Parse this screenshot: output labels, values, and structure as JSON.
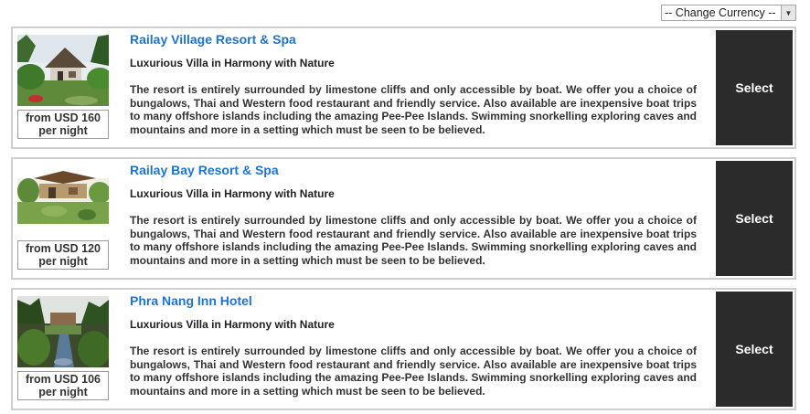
{
  "currency": {
    "label": "-- Change Currency --",
    "arrow_icon": "triangle-down"
  },
  "hotels": [
    {
      "name": "Railay Village Resort & Spa",
      "tagline": "Luxurious Villa in Harmony with Nature",
      "description": "The resort is entirely surrounded by limestone cliffs and only accessible by boat. We offer you a choice of bungalows, Thai and Western food restaurant and friendly service. Also available are inexpensive boat trips to many offshore islands including the amazing Pee-Pee Islands. Swimming snorkelling exploring caves and mountains and more in a setting which must be seen to be believed.",
      "price_line1": "from USD 160",
      "price_line2": "per night",
      "select_label": "Select"
    },
    {
      "name": "Railay Bay Resort & Spa",
      "tagline": "Luxurious Villa in Harmony with Nature",
      "description": "The resort is entirely surrounded by limestone cliffs and only accessible by boat. We offer you a choice of bungalows, Thai and Western food restaurant and friendly service. Also available are inexpensive boat trips to many offshore islands including the amazing Pee-Pee Islands. Swimming snorkelling exploring caves and mountains and more in a setting which must be seen to be believed.",
      "price_line1": "from USD 120",
      "price_line2": "per night",
      "select_label": "Select"
    },
    {
      "name": "Phra Nang Inn Hotel",
      "tagline": "Luxurious Villa in Harmony with Nature",
      "description": "The resort is entirely surrounded by limestone cliffs and only accessible by boat. We offer you a choice of bungalows, Thai and Western food restaurant and friendly service. Also available are inexpensive boat trips to many offshore islands including the amazing Pee-Pee Islands. Swimming snorkelling exploring caves and mountains and more in a setting which must be seen to be believed.",
      "price_line1": "from USD 106",
      "price_line2": "per night",
      "select_label": "Select"
    }
  ]
}
